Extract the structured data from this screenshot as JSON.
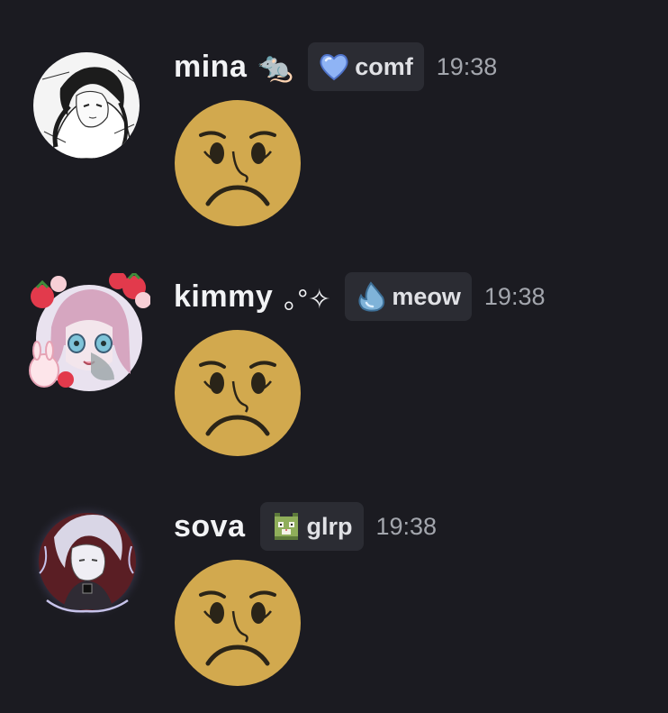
{
  "messages": [
    {
      "username": "mina",
      "name_decoration": "🐀",
      "tag": {
        "label": "comf",
        "icon": "blue-heart-icon"
      },
      "timestamp": "19:38",
      "content_emoji": "worried-face-icon"
    },
    {
      "username": "kimmy",
      "name_decoration": "｡°✧",
      "tag": {
        "label": "meow",
        "icon": "water-drop-icon"
      },
      "timestamp": "19:38",
      "content_emoji": "worried-face-icon"
    },
    {
      "username": "sova",
      "name_decoration": "",
      "tag": {
        "label": "glrp",
        "icon": "pixel-cat-icon"
      },
      "timestamp": "19:38",
      "content_emoji": "worried-face-icon"
    }
  ],
  "colors": {
    "background": "#1b1b21",
    "tag_background": "#2b2c33",
    "username": "#f2f3f5",
    "timestamp": "#a3a6ad",
    "emoji_face": "#d2a94e"
  }
}
